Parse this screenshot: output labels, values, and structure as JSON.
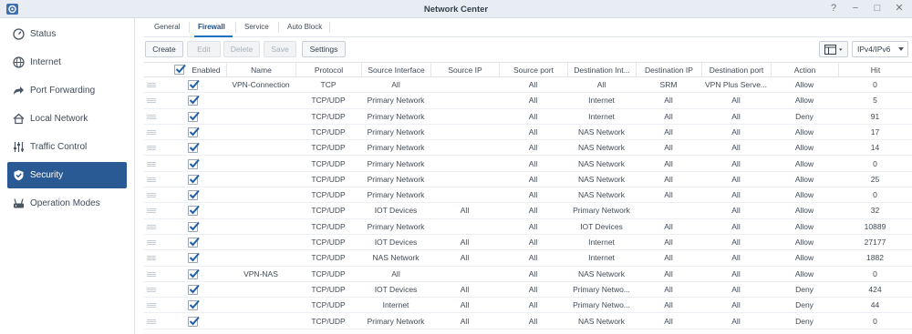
{
  "window": {
    "title": "Network Center"
  },
  "window_controls": [
    "?",
    "−",
    "□",
    "✕"
  ],
  "sidebar": {
    "items": [
      {
        "label": "Status",
        "icon": "status-icon"
      },
      {
        "label": "Internet",
        "icon": "globe-icon"
      },
      {
        "label": "Port Forwarding",
        "icon": "arrow-icon"
      },
      {
        "label": "Local Network",
        "icon": "home-icon"
      },
      {
        "label": "Traffic Control",
        "icon": "sliders-icon"
      },
      {
        "label": "Security",
        "icon": "shield-icon",
        "active": true
      },
      {
        "label": "Operation Modes",
        "icon": "router-icon"
      }
    ]
  },
  "tabs": [
    {
      "label": "General"
    },
    {
      "label": "Firewall",
      "active": true
    },
    {
      "label": "Service"
    },
    {
      "label": "Auto Block"
    }
  ],
  "toolbar": {
    "create": "Create",
    "edit": "Edit",
    "delete": "Delete",
    "save": "Save",
    "settings": "Settings",
    "ip_select": "IPv4/IPv6"
  },
  "table": {
    "columns": [
      "Enabled",
      "Name",
      "Protocol",
      "Source Interface",
      "Source IP",
      "Source port",
      "Destination Int...",
      "Destination IP",
      "Destination port",
      "Action",
      "Hit"
    ],
    "rows": [
      [
        "VPN-Connection",
        "TCP",
        "All",
        "",
        "All",
        "All",
        "SRM",
        "VPN Plus Serve...",
        "Allow",
        "0"
      ],
      [
        "",
        "TCP/UDP",
        "Primary Network",
        "",
        "All",
        "Internet",
        "All",
        "All",
        "Allow",
        "5"
      ],
      [
        "",
        "TCP/UDP",
        "Primary Network",
        "",
        "All",
        "Internet",
        "All",
        "All",
        "Deny",
        "91"
      ],
      [
        "",
        "TCP/UDP",
        "Primary Network",
        "",
        "All",
        "NAS Network",
        "All",
        "All",
        "Allow",
        "17"
      ],
      [
        "",
        "TCP/UDP",
        "Primary Network",
        "",
        "All",
        "NAS Network",
        "All",
        "All",
        "Allow",
        "14"
      ],
      [
        "",
        "TCP/UDP",
        "Primary Network",
        "",
        "All",
        "NAS Network",
        "All",
        "All",
        "Allow",
        "0"
      ],
      [
        "",
        "TCP/UDP",
        "Primary Network",
        "",
        "All",
        "NAS Network",
        "All",
        "All",
        "Allow",
        "25"
      ],
      [
        "",
        "TCP/UDP",
        "Primary Network",
        "",
        "All",
        "NAS Network",
        "All",
        "All",
        "Allow",
        "0"
      ],
      [
        "",
        "TCP/UDP",
        "IOT Devices",
        "All",
        "All",
        "Primary Network",
        "",
        "All",
        "Allow",
        "32"
      ],
      [
        "",
        "TCP/UDP",
        "Primary Network",
        "",
        "All",
        "IOT Devices",
        "All",
        "All",
        "Allow",
        "10889"
      ],
      [
        "",
        "TCP/UDP",
        "IOT Devices",
        "All",
        "All",
        "Internet",
        "All",
        "All",
        "Allow",
        "27177"
      ],
      [
        "",
        "TCP/UDP",
        "NAS Network",
        "All",
        "All",
        "Internet",
        "All",
        "All",
        "Allow",
        "1882"
      ],
      [
        "VPN-NAS",
        "TCP/UDP",
        "All",
        "",
        "All",
        "NAS Network",
        "All",
        "All",
        "Allow",
        "0"
      ],
      [
        "",
        "TCP/UDP",
        "IOT Devices",
        "All",
        "All",
        "Primary Netwo...",
        "All",
        "All",
        "Deny",
        "424"
      ],
      [
        "",
        "TCP/UDP",
        "Internet",
        "All",
        "All",
        "Primary Netwo...",
        "All",
        "All",
        "Deny",
        "44"
      ],
      [
        "",
        "TCP/UDP",
        "Primary Network",
        "All",
        "All",
        "NAS Network",
        "All",
        "All",
        "Deny",
        "0"
      ]
    ]
  },
  "colors": {
    "accent": "#2a5a94",
    "tab_active": "#1e4f86",
    "check": "#1f5fa8"
  }
}
